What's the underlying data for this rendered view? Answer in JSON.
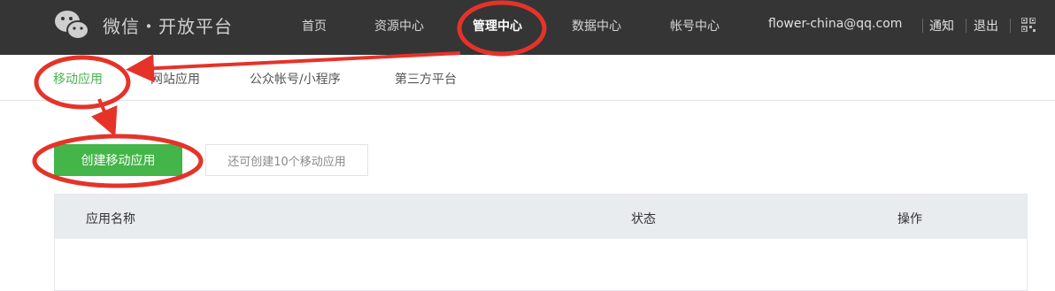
{
  "header": {
    "brand": "微信・开放平台",
    "nav": [
      {
        "label": "首页"
      },
      {
        "label": "资源中心"
      },
      {
        "label": "管理中心"
      },
      {
        "label": "数据中心"
      },
      {
        "label": "帐号中心"
      }
    ],
    "user": {
      "email": "flower-china@qq.com",
      "notify_label": "通知",
      "logout_label": "退出"
    }
  },
  "subnav": {
    "items": [
      {
        "label": "移动应用"
      },
      {
        "label": "网站应用"
      },
      {
        "label": "公众帐号/小程序"
      },
      {
        "label": "第三方平台"
      }
    ]
  },
  "main": {
    "create_button_label": "创建移动应用",
    "quota_text": "还可创建10个移动应用",
    "table": {
      "columns": [
        "应用名称",
        "状态",
        "操作"
      ]
    }
  },
  "colors": {
    "header_bg": "#353535",
    "accent_green": "#44b549",
    "annotation_red": "#e5332a"
  }
}
